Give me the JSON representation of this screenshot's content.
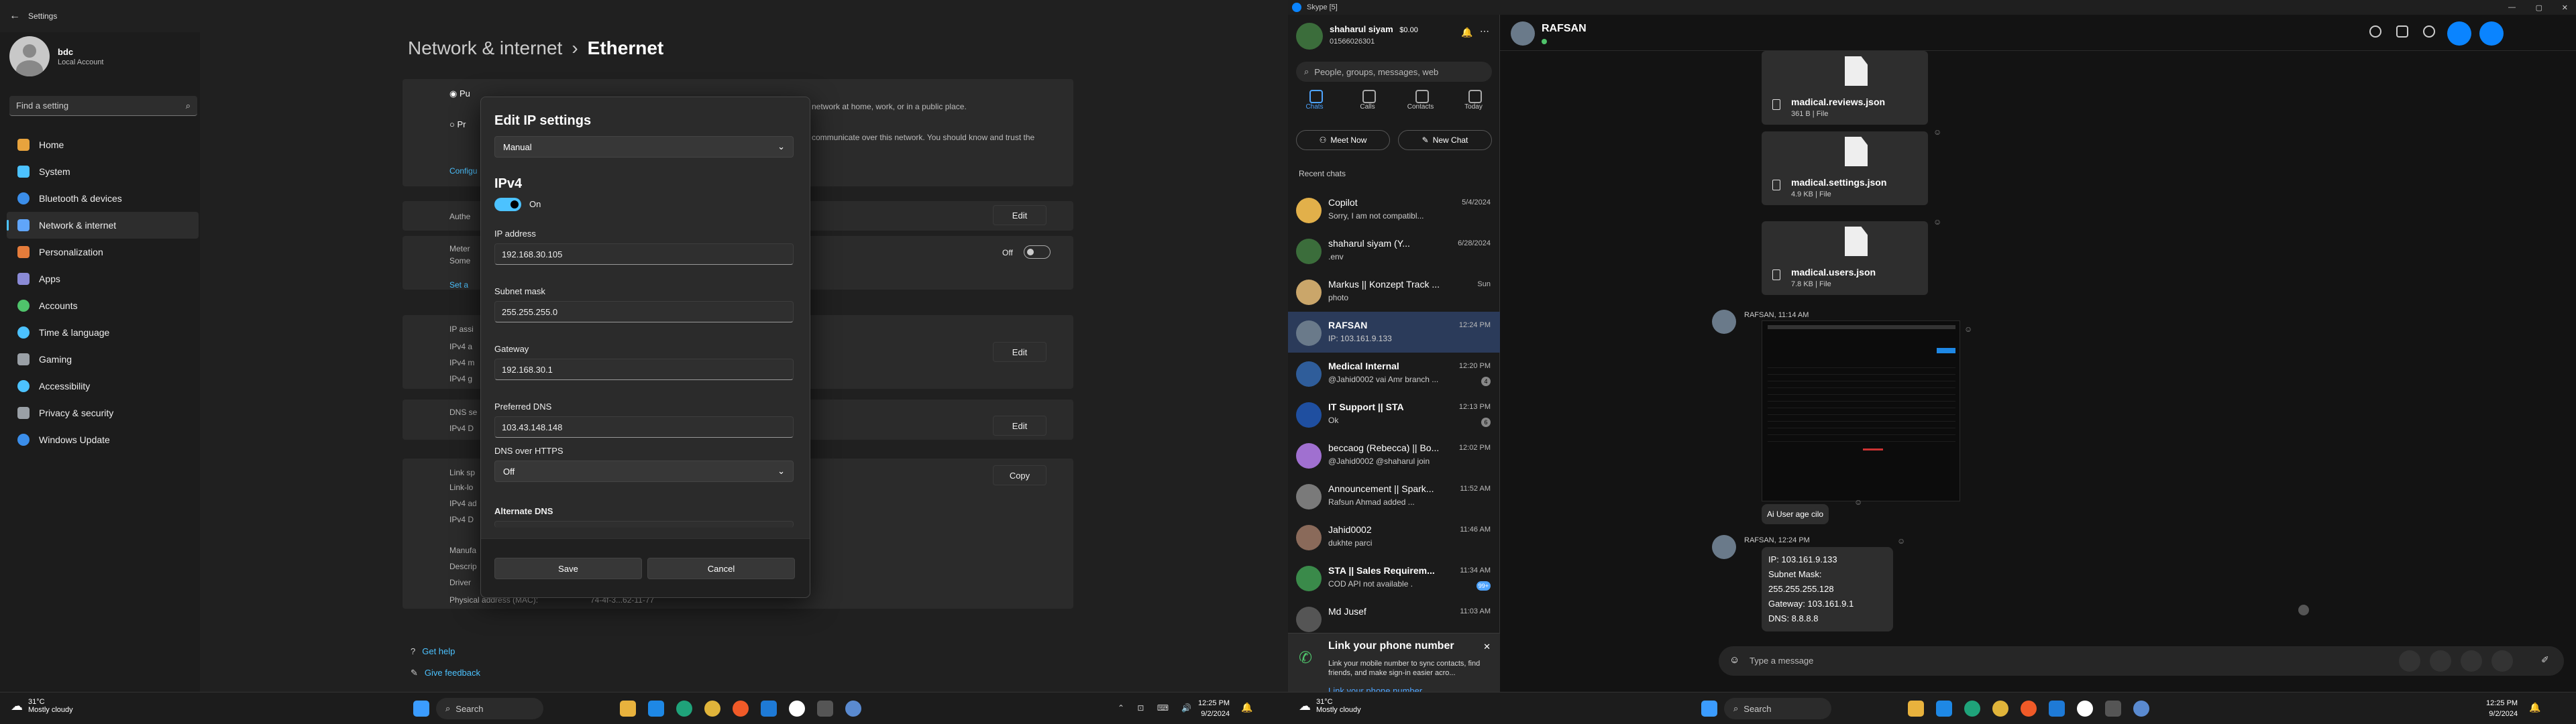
{
  "settings": {
    "window_title": "Settings",
    "user": {
      "name": "bdc",
      "account": "Local Account"
    },
    "search_placeholder": "Find a setting",
    "nav": [
      {
        "label": "Home",
        "color": "#e8a33d"
      },
      {
        "label": "System",
        "color": "#4cc2ff"
      },
      {
        "label": "Bluetooth & devices",
        "color": "#3b8eea"
      },
      {
        "label": "Network & internet",
        "color": "#60a5fa"
      },
      {
        "label": "Personalization",
        "color": "#e57c3b"
      },
      {
        "label": "Apps",
        "color": "#8a8ad6"
      },
      {
        "label": "Accounts",
        "color": "#4fc36b"
      },
      {
        "label": "Time & language",
        "color": "#4cc2ff"
      },
      {
        "label": "Gaming",
        "color": "#9aa0a6"
      },
      {
        "label": "Accessibility",
        "color": "#4cc2ff"
      },
      {
        "label": "Privacy & security",
        "color": "#9aa0a6"
      },
      {
        "label": "Windows Update",
        "color": "#3b8eea"
      }
    ],
    "breadcrumb": {
      "parent": "Network & internet",
      "separator": "›",
      "current": "Ethernet"
    },
    "bg_text": {
      "network_hint": "network at home, work, or in a public place.",
      "network_hint2": "communicate over this network. You should know and trust the",
      "edit": "Edit",
      "off": "Off",
      "copy": "Copy",
      "physical_label": "Physical address (MAC):",
      "physical_value": "74-4f-3...62-11-77",
      "auth": "Authe",
      "metered": "Meter",
      "some": "Some",
      "set": "Set a",
      "ipa": "IP assi",
      "ipv4a": "IPv4 a",
      "ipv4m": "IPv4 m",
      "ipv4g": "IPv4 g",
      "dnss": "DNS se",
      "ipv4d": "IPv4 D",
      "links": "Link sp",
      "linkl": "Link-lo",
      "ipv4ad": "IPv4 ad",
      "ipv4dn": "IPv4 D",
      "manu": "Manufa",
      "descr": "Descrip",
      "driver": "Driver",
      "pub": "Pu",
      "pri": "Pr",
      "conf": "Configu"
    },
    "help": {
      "get_help": "Get help",
      "feedback": "Give feedback"
    }
  },
  "dialog": {
    "title": "Edit IP settings",
    "mode": "Manual",
    "section": "IPv4",
    "toggle_label": "On",
    "fields": [
      {
        "label": "IP address",
        "value": "192.168.30.105"
      },
      {
        "label": "Subnet mask",
        "value": "255.255.255.0"
      },
      {
        "label": "Gateway",
        "value": "192.168.30.1"
      },
      {
        "label": "Preferred DNS",
        "value": "103.43.148.148"
      }
    ],
    "doh_label": "DNS over HTTPS",
    "doh_value": "Off",
    "alt_dns_label": "Alternate DNS",
    "save": "Save",
    "cancel": "Cancel"
  },
  "taskbar": {
    "temp": "31°C",
    "weather": "Mostly cloudy",
    "search": "Search",
    "time": "12:25 PM",
    "date": "9/2/2024"
  },
  "skype": {
    "window_title": "Skype [5]",
    "me": {
      "name": "shaharul siyam",
      "credit": "$0.00",
      "phone": "01566026301"
    },
    "search_placeholder": "People, groups, messages, web",
    "tabs": [
      "Chats",
      "Calls",
      "Contacts",
      "Today"
    ],
    "meet_now": "Meet Now",
    "new_chat": "New Chat",
    "recent_chats": "Recent chats",
    "chats": [
      {
        "name": "Copilot",
        "msg": "Sorry, I am not compatibl...",
        "time": "5/4/2024",
        "color": "#e2b04a",
        "bold": false,
        "badge": ""
      },
      {
        "name": "shaharul siyam (Y...",
        "msg": ".env",
        "time": "6/28/2024",
        "color": "#3b6d3b",
        "bold": false,
        "badge": ""
      },
      {
        "name": "Markus || Konzept Track ...",
        "msg": "photo",
        "time": "Sun",
        "color": "#caa66a",
        "bold": false,
        "badge": ""
      },
      {
        "name": "RAFSAN",
        "msg": "IP: 103.161.9.133",
        "time": "12:24 PM",
        "color": "#6a7a8a",
        "bold": true,
        "badge": ""
      },
      {
        "name": "Medical Internal",
        "msg": "@Jahid0002 vai Amr branch ...",
        "time": "12:20 PM",
        "color": "#2f5d9a",
        "bold": true,
        "badge": "4"
      },
      {
        "name": "IT Support || STA",
        "msg": "Ok",
        "time": "12:13 PM",
        "color": "#1f4fa0",
        "bold": true,
        "badge": "6"
      },
      {
        "name": "beccaog (Rebecca) || Bo...",
        "msg": "@Jahid0002 @shaharul join",
        "time": "12:02 PM",
        "color": "#a070d0",
        "bold": false,
        "badge": ""
      },
      {
        "name": "Announcement || Spark...",
        "msg": "Rafsun Ahmad added ...",
        "time": "11:52 AM",
        "color": "#7a7a7a",
        "bold": false,
        "badge": ""
      },
      {
        "name": "Jahid0002",
        "msg": "dukhte parci",
        "time": "11:46 AM",
        "color": "#8a6a5a",
        "bold": false,
        "badge": ""
      },
      {
        "name": "STA || Sales Requirem...",
        "msg": "COD API not available .",
        "time": "11:34 AM",
        "color": "#3a8a4a",
        "bold": true,
        "badge": "99+"
      },
      {
        "name": "Md Jusef",
        "msg": "",
        "time": "11:03 AM",
        "color": "#555555",
        "bold": false,
        "badge": ""
      }
    ],
    "link_card": {
      "title": "Link your phone number",
      "text": "Link your mobile number to sync contacts, find friends, and make sign-in easier acro...",
      "link": "Link your phone number"
    },
    "conversation": {
      "name": "RAFSAN",
      "files": [
        {
          "name": "madical.reviews.json",
          "size": "361 B | File"
        },
        {
          "name": "madical.settings.json",
          "size": "4.9 KB | File"
        },
        {
          "name": "madical.users.json",
          "size": "7.8 KB | File"
        }
      ],
      "msg1_header": "RAFSAN, 11:14 AM",
      "caption": "Ai User age cilo",
      "msg2_header": "RAFSAN, 12:24 PM",
      "msg2_lines": [
        "IP: 103.161.9.133",
        "Subnet Mask: 255.255.255.128",
        "Gateway: 103.161.9.1",
        "DNS: 8.8.8.8"
      ],
      "composer_placeholder": "Type a message"
    }
  }
}
